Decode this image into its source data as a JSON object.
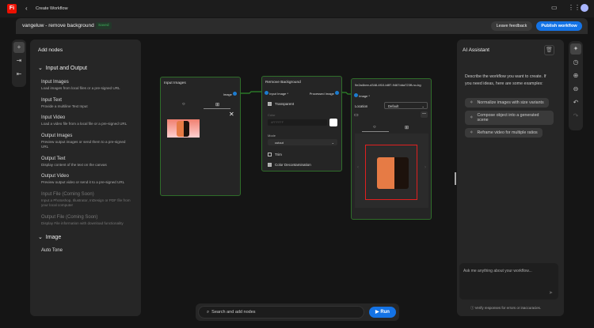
{
  "topbar": {
    "logo": "Fi",
    "back_label": "Create Workflow"
  },
  "header": {
    "title": "vangeluw - remove background",
    "status": "Saved",
    "leave_feedback": "Leave feedback",
    "publish": "Publish workflow"
  },
  "add_nodes": {
    "title": "Add nodes",
    "sections": [
      {
        "label": "Input and Output",
        "items": [
          {
            "title": "Input Images",
            "desc": "Load images from local files or a pre-signed URL"
          },
          {
            "title": "Input Text",
            "desc": "Provide a multiline Text Input"
          },
          {
            "title": "Input Video",
            "desc": "Load a video file from a local file or a pre-signed URL"
          },
          {
            "title": "Output Images",
            "desc": "Preview output images or send them to a pre-signed URL"
          },
          {
            "title": "Output Text",
            "desc": "Display content of the text on the canvas"
          },
          {
            "title": "Output Video",
            "desc": "Preview output video or send it to a pre-signed URL"
          },
          {
            "title": "Input File (Coming Soon)",
            "desc": "Input a Photoshop, Illustrator, InDesign or PDF file from your local computer"
          },
          {
            "title": "Output File (Coming Soon)",
            "desc": "Display File information with download functionality"
          }
        ]
      },
      {
        "label": "Image",
        "items": [
          {
            "title": "Auto Tone"
          }
        ]
      }
    ]
  },
  "nodes": {
    "input_images": {
      "title": "Input Images",
      "port": "Image"
    },
    "remove_bg": {
      "title": "Remove Background",
      "in_port": "Input Image *",
      "out_port": "Processed Image",
      "transparent": "Transparent",
      "color_label": "Color",
      "color_value": "#FFFFFF",
      "mode_label": "Mode",
      "mode_value": "cutout",
      "trim": "Trim",
      "decontam": "Color Decontamination",
      "transparent_checked": true,
      "trim_checked": false,
      "decontam_checked": true
    },
    "output": {
      "title": "9e2a4bee-d348-4f10-b8f7-9467dda723ff-no-bg",
      "port": "Image *",
      "location_label": "Location",
      "location_value": "Default"
    }
  },
  "ai": {
    "title": "AI Assistant",
    "intro": "Describe the workflow you want to create. If you need ideas, here are some examples:",
    "examples": [
      "Normalize images with size variants",
      "Compose object into a generated scene",
      "Reframe video for multiple ratios"
    ],
    "placeholder": "Ask me anything about your workflow...",
    "disclaimer": "Verify responses for errors or inaccuracies."
  },
  "bottom": {
    "search_placeholder": "Search and add nodes",
    "run": "Run"
  }
}
